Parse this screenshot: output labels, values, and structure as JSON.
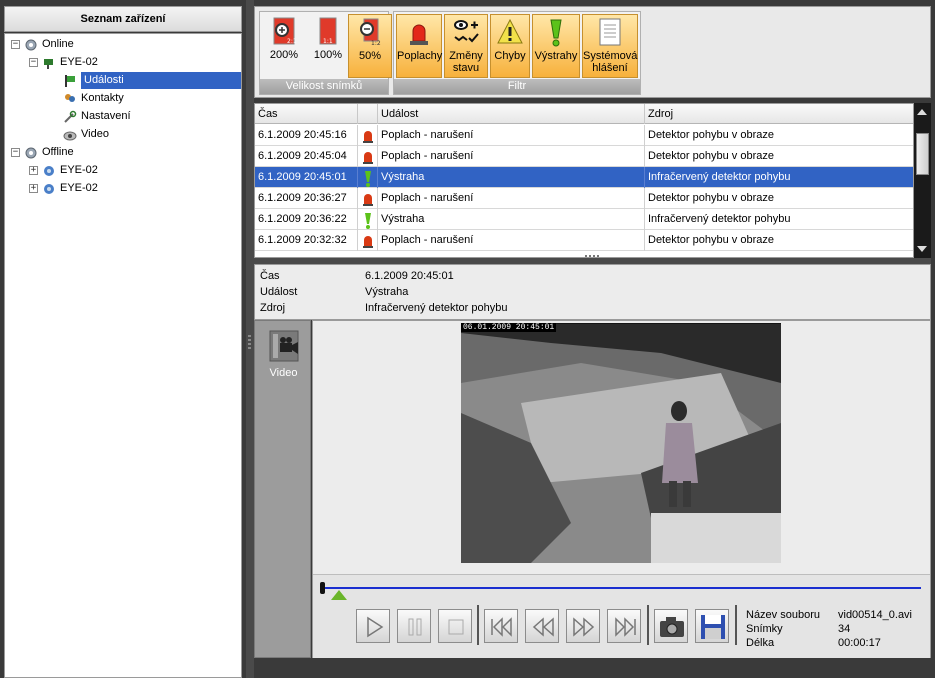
{
  "device_list": {
    "title": "Seznam zařízení",
    "tree": {
      "online_label": "Online",
      "online_device": "EYE-02",
      "children": [
        "Události",
        "Kontakty",
        "Nastavení",
        "Video"
      ],
      "offline_label": "Offline",
      "offline_devices": [
        "EYE-02",
        "EYE-02"
      ]
    }
  },
  "toolbar": {
    "snapshot_group": {
      "label": "Velikost snímků",
      "buttons": [
        {
          "label": "200%",
          "icon": "zoom-200-icon",
          "badge": "2:1"
        },
        {
          "label": "100%",
          "icon": "zoom-100-icon",
          "badge": "1:1"
        },
        {
          "label": "50%",
          "icon": "zoom-50-icon",
          "badge": "1:2",
          "active": true
        }
      ]
    },
    "filter_group": {
      "label": "Filtr",
      "buttons": [
        {
          "label": "Poplachy",
          "icon": "alarm-siren-icon",
          "active": true
        },
        {
          "label": "Změny stavu",
          "icon": "state-change-icon",
          "active": true
        },
        {
          "label": "Chyby",
          "icon": "error-icon",
          "active": true
        },
        {
          "label": "Výstrahy",
          "icon": "warning-icon",
          "active": true
        },
        {
          "label": "Systémová hlášení",
          "icon": "system-message-icon",
          "active": true
        }
      ]
    }
  },
  "events_table": {
    "columns": [
      "Čas",
      "",
      "Událost",
      "Zdroj"
    ],
    "rows": [
      {
        "time": "6.1.2009 20:45:16",
        "type": "alarm",
        "event": "Poplach - narušení",
        "source": "Detektor pohybu v obraze"
      },
      {
        "time": "6.1.2009 20:45:04",
        "type": "alarm",
        "event": "Poplach - narušení",
        "source": "Detektor pohybu v obraze"
      },
      {
        "time": "6.1.2009 20:45:01",
        "type": "warning",
        "event": "Výstraha",
        "source": "Infračervený detektor pohybu",
        "selected": true
      },
      {
        "time": "6.1.2009 20:36:27",
        "type": "alarm",
        "event": "Poplach - narušení",
        "source": "Detektor pohybu v obraze"
      },
      {
        "time": "6.1.2009 20:36:22",
        "type": "warning",
        "event": "Výstraha",
        "source": "Infračervený detektor pohybu"
      },
      {
        "time": "6.1.2009 20:32:32",
        "type": "alarm",
        "event": "Poplach - narušení",
        "source": "Detektor pohybu v obraze"
      }
    ]
  },
  "details": {
    "time_label": "Čas",
    "time_value": "6.1.2009 20:45:01",
    "event_label": "Událost",
    "event_value": "Výstraha",
    "source_label": "Zdroj",
    "source_value": "Infračervený detektor pohybu"
  },
  "video_panel": {
    "tab_label": "Video",
    "frame_timestamp": "06.01.2009 20:45:01",
    "file_name_label": "Název souboru",
    "file_name_value": "vid00514_0.avi",
    "frames_label": "Snímky",
    "frames_value": "34",
    "length_label": "Délka",
    "length_value": "00:00:17",
    "playback_position": 0.03
  },
  "colors": {
    "selection": "#3163c4",
    "toolbar_active": "#f7b13c",
    "timeline": "#1a2fd0",
    "alarm": "#d93a14",
    "warning": "#5cc21a"
  }
}
